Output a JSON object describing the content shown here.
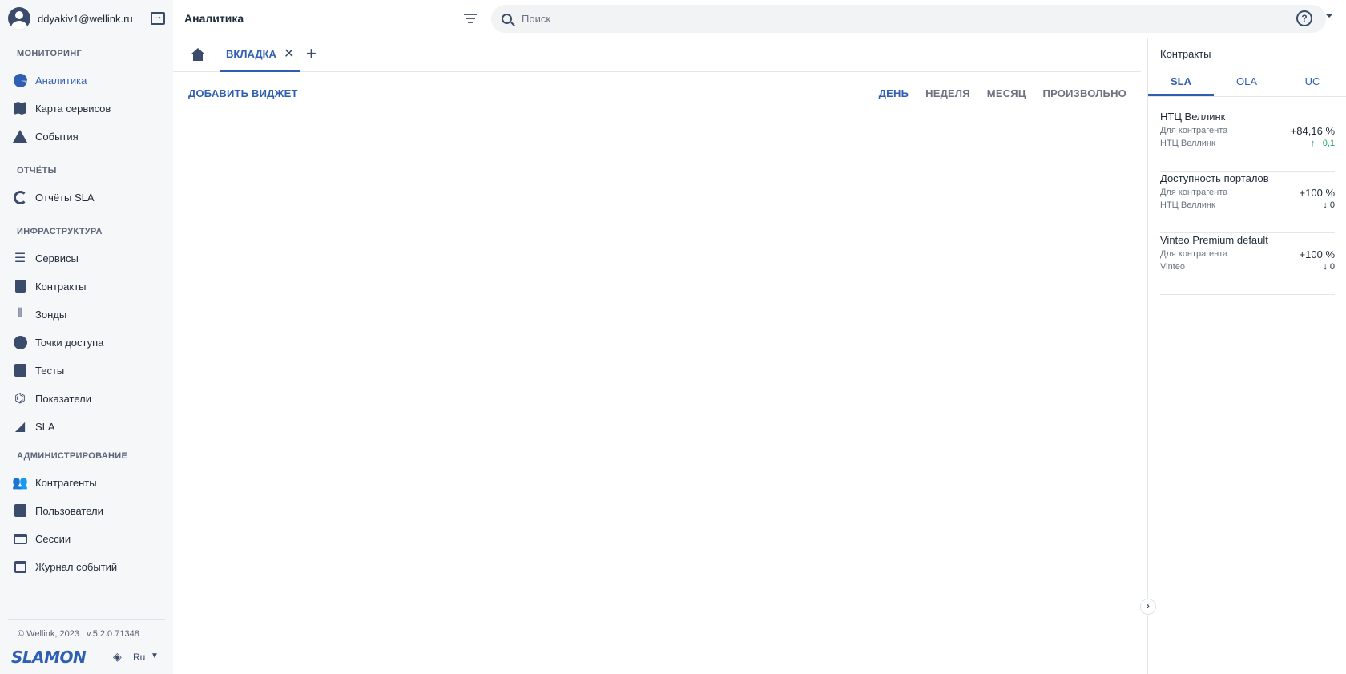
{
  "user": {
    "email": "ddyakiv1@wellink.ru"
  },
  "header": {
    "title": "Аналитика",
    "search_placeholder": "Поиск"
  },
  "sidebar": {
    "sections": [
      {
        "title": "МОНИТОРИНГ",
        "items": [
          {
            "label": "Аналитика",
            "icon": "analytics-icon",
            "active": true
          },
          {
            "label": "Карта сервисов",
            "icon": "map-icon"
          },
          {
            "label": "События",
            "icon": "warning-icon"
          }
        ]
      },
      {
        "title": "ОТЧЁТЫ",
        "items": [
          {
            "label": "Отчёты SLA",
            "icon": "report-icon"
          }
        ]
      },
      {
        "title": "ИНФРАСТРУКТУРА",
        "items": [
          {
            "label": "Сервисы",
            "icon": "list-icon"
          },
          {
            "label": "Контракты",
            "icon": "document-icon"
          },
          {
            "label": "Зонды",
            "icon": "probe-icon"
          },
          {
            "label": "Точки доступа",
            "icon": "access-point-icon"
          },
          {
            "label": "Тесты",
            "icon": "clipboard-check-icon"
          },
          {
            "label": "Показатели",
            "icon": "metrics-icon"
          },
          {
            "label": "SLA",
            "icon": "sla-icon"
          }
        ]
      },
      {
        "title": "АДМИНИСТРИРОВАНИЕ",
        "items": [
          {
            "label": "Контрагенты",
            "icon": "people-icon"
          },
          {
            "label": "Пользователи",
            "icon": "user-card-icon"
          },
          {
            "label": "Сессии",
            "icon": "window-icon"
          },
          {
            "label": "Журнал событий",
            "icon": "calendar-icon"
          }
        ]
      }
    ],
    "footer": {
      "copyright": "© Wellink, 2023 | v.5.2.0.71348",
      "logo": "SLAMON",
      "language": "Ru"
    }
  },
  "tabs": {
    "active_label": "ВКЛАДКА"
  },
  "toolbar": {
    "add_widget": "ДОБАВИТЬ ВИДЖЕТ",
    "periods": [
      "ДЕНЬ",
      "НЕДЕЛЯ",
      "МЕСЯЦ",
      "ПРОИЗВОЛЬНО"
    ],
    "active_period": "ДЕНЬ"
  },
  "panel": {
    "title": "Контракты",
    "tabs": [
      "SLA",
      "OLA",
      "UC"
    ],
    "active_tab": "SLA",
    "contracts": [
      {
        "name": "НТЦ Веллинк",
        "sub1": "Для контрагента",
        "sub2": "НТЦ Веллинк",
        "value": "+84,16 %",
        "delta": "↑ +0,1",
        "trend": "up"
      },
      {
        "name": "Доступность порталов",
        "sub1": "Для контрагента",
        "sub2": "НТЦ Веллинк",
        "value": "+100 %",
        "delta": "↓ 0",
        "trend": "down"
      },
      {
        "name": "Vinteo Premium default",
        "sub1": "Для контрагента",
        "sub2": "Vinteo",
        "value": "+100 %",
        "delta": "↓ 0",
        "trend": "down"
      }
    ]
  },
  "colors": {
    "accent": "#2f5fb3",
    "positive": "#22a06b",
    "sidebar_bg": "#f6f7f9"
  }
}
